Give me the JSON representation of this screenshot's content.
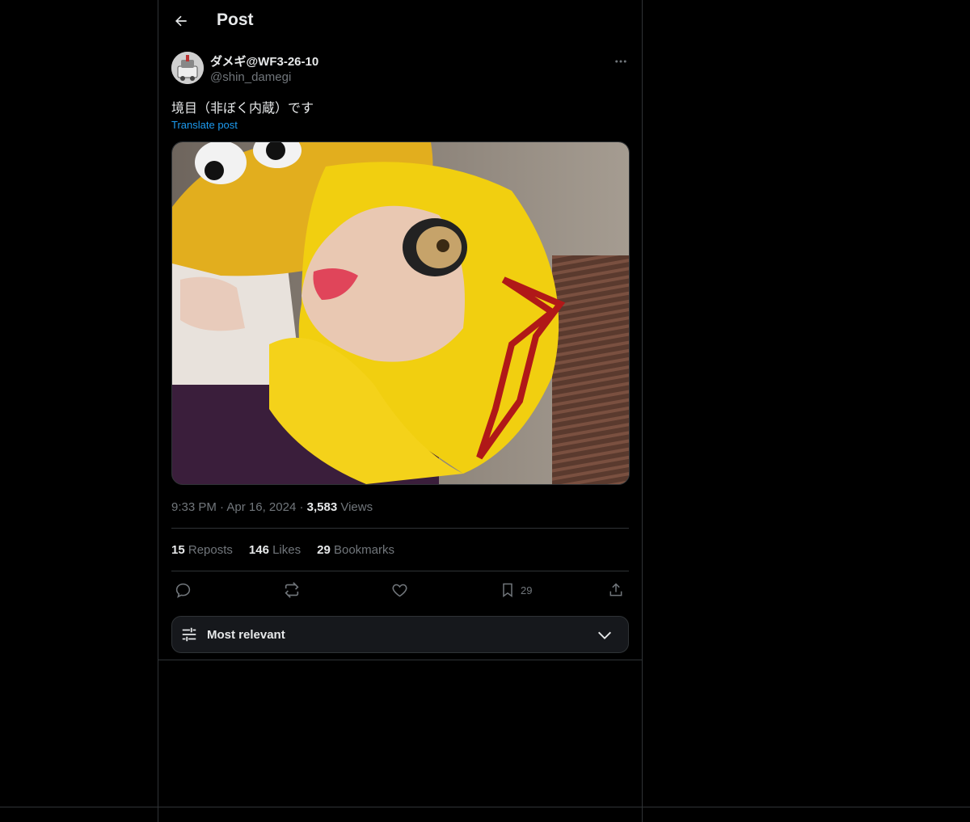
{
  "header": {
    "title": "Post",
    "back_icon": "arrow-left-icon"
  },
  "post": {
    "author": {
      "display_name": "ダメギ@WF3-26-10",
      "handle": "@shin_damegi"
    },
    "text": "境目（非ぼく内蔵）です",
    "translate_label": "Translate post",
    "time": "9:33 PM",
    "date": "Apr 16, 2024",
    "sep": "·",
    "views_count": "3,583",
    "views_label": "Views"
  },
  "stats": {
    "reposts_count": "15",
    "reposts_label": "Reposts",
    "likes_count": "146",
    "likes_label": "Likes",
    "bookmarks_count": "29",
    "bookmarks_label": "Bookmarks"
  },
  "actions": {
    "reply_icon": "reply-icon",
    "repost_icon": "repost-icon",
    "like_icon": "heart-icon",
    "bookmark_icon": "bookmark-icon",
    "bookmark_count": "29",
    "share_icon": "share-icon"
  },
  "replies_sort": {
    "label": "Most relevant",
    "icon": "sliders-icon",
    "chevron": "chevron-down-icon"
  },
  "colors": {
    "background": "#000000",
    "text": "#e7e9ea",
    "muted": "#71767b",
    "link": "#1d9bf0",
    "border": "#2f3336"
  }
}
